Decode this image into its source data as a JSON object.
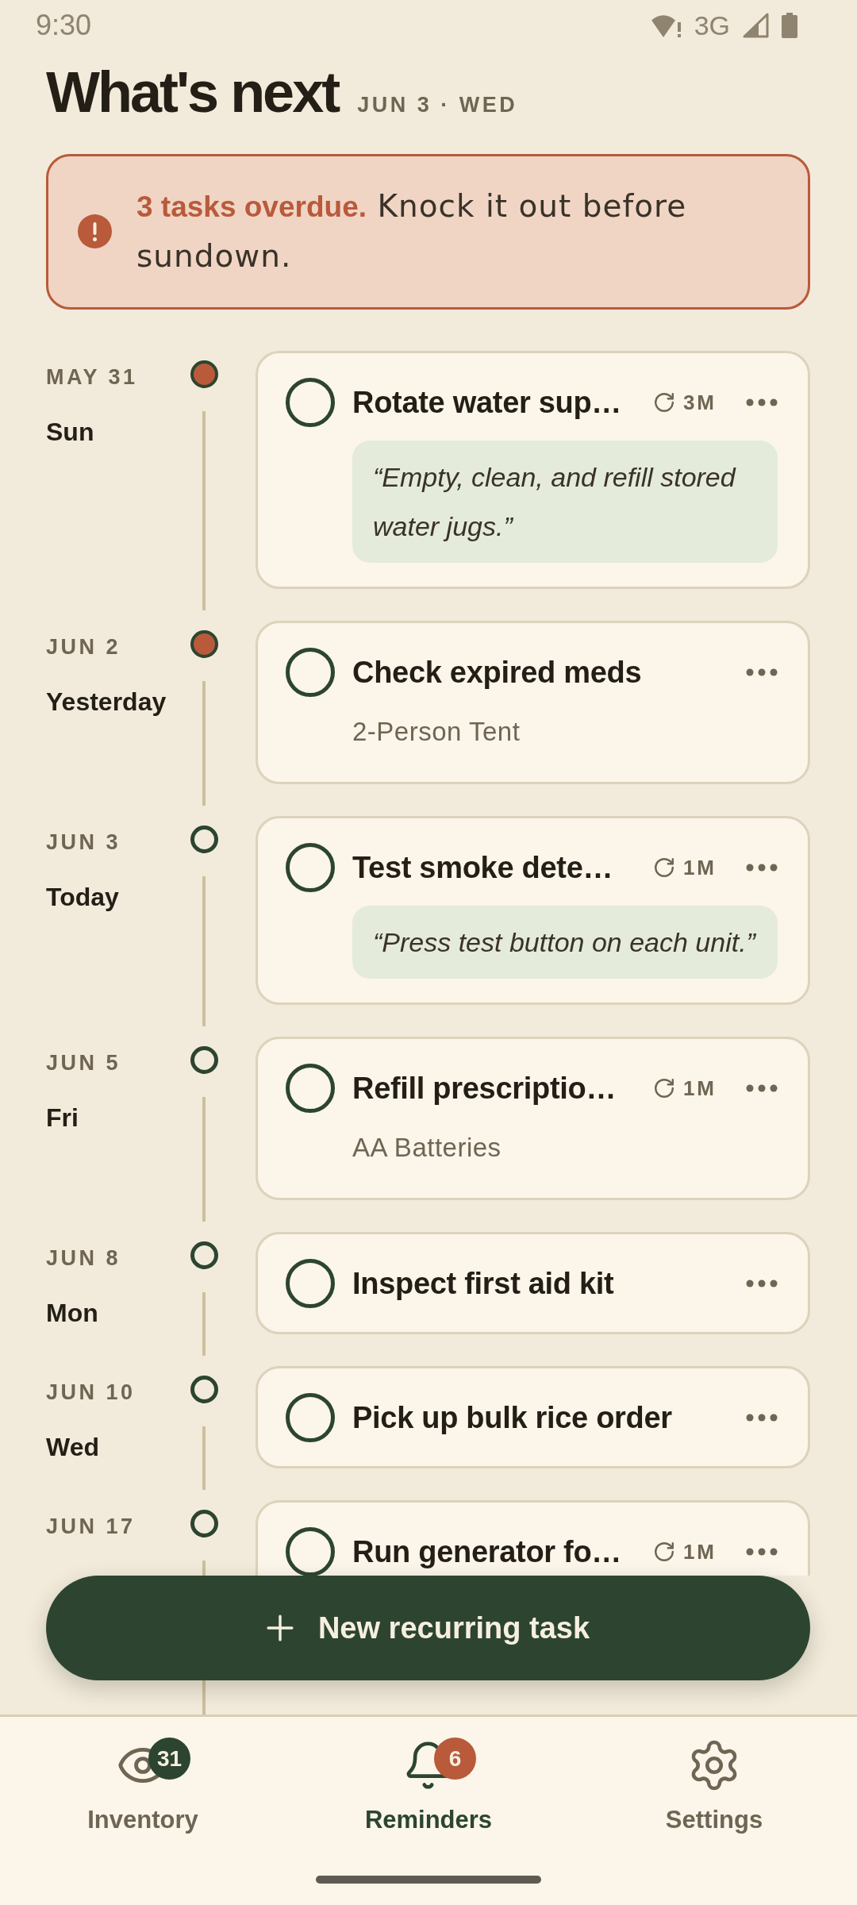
{
  "status_bar": {
    "time": "9:30",
    "network": "3G"
  },
  "header": {
    "title": "What's next",
    "date": "JUN 3 · WED"
  },
  "alert": {
    "message": "**3 tasks overdue.** Knock it out before sundown."
  },
  "timeline": [
    {
      "date": "MAY 31",
      "day": "Sun",
      "overdue": true,
      "task": {
        "title": "Rotate water sup…",
        "checked": false,
        "repeat": "3M",
        "note": "“Empty, clean, and refill stored water jugs.”"
      }
    },
    {
      "date": "JUN 2",
      "day": "Yesterday",
      "overdue": true,
      "task": {
        "title": "Check expired meds",
        "checked": false,
        "item": "2-Person Tent"
      }
    },
    {
      "date": "JUN 3",
      "day": "Today",
      "overdue": false,
      "task": {
        "title": "Test smoke dete…",
        "checked": false,
        "repeat": "1M",
        "note": "“Press test button on each unit.”"
      }
    },
    {
      "date": "JUN 5",
      "day": "Fri",
      "overdue": false,
      "task": {
        "title": "Refill prescriptio…",
        "checked": false,
        "repeat": "1M",
        "item": "AA Batteries"
      }
    },
    {
      "date": "JUN 8",
      "day": "Mon",
      "overdue": false,
      "task": {
        "title": "Inspect first aid kit",
        "checked": false
      }
    },
    {
      "date": "JUN 10",
      "day": "Wed",
      "overdue": false,
      "task": {
        "title": "Pick up bulk rice order",
        "checked": false
      }
    },
    {
      "date": "JUN 17",
      "overdue": false,
      "task": {
        "title": "Run generator fo…",
        "checked": false,
        "repeat": "1M"
      }
    }
  ],
  "fab": {
    "label": "New recurring task"
  },
  "bottom_nav": [
    {
      "label": "Inventory",
      "selected": false,
      "badge": {
        "text": "31",
        "color": "#2d4530"
      }
    },
    {
      "label": "Reminders",
      "selected": true,
      "badge": {
        "text": "6",
        "color": "#b95a3b"
      }
    },
    {
      "label": "Settings",
      "selected": false
    }
  ]
}
